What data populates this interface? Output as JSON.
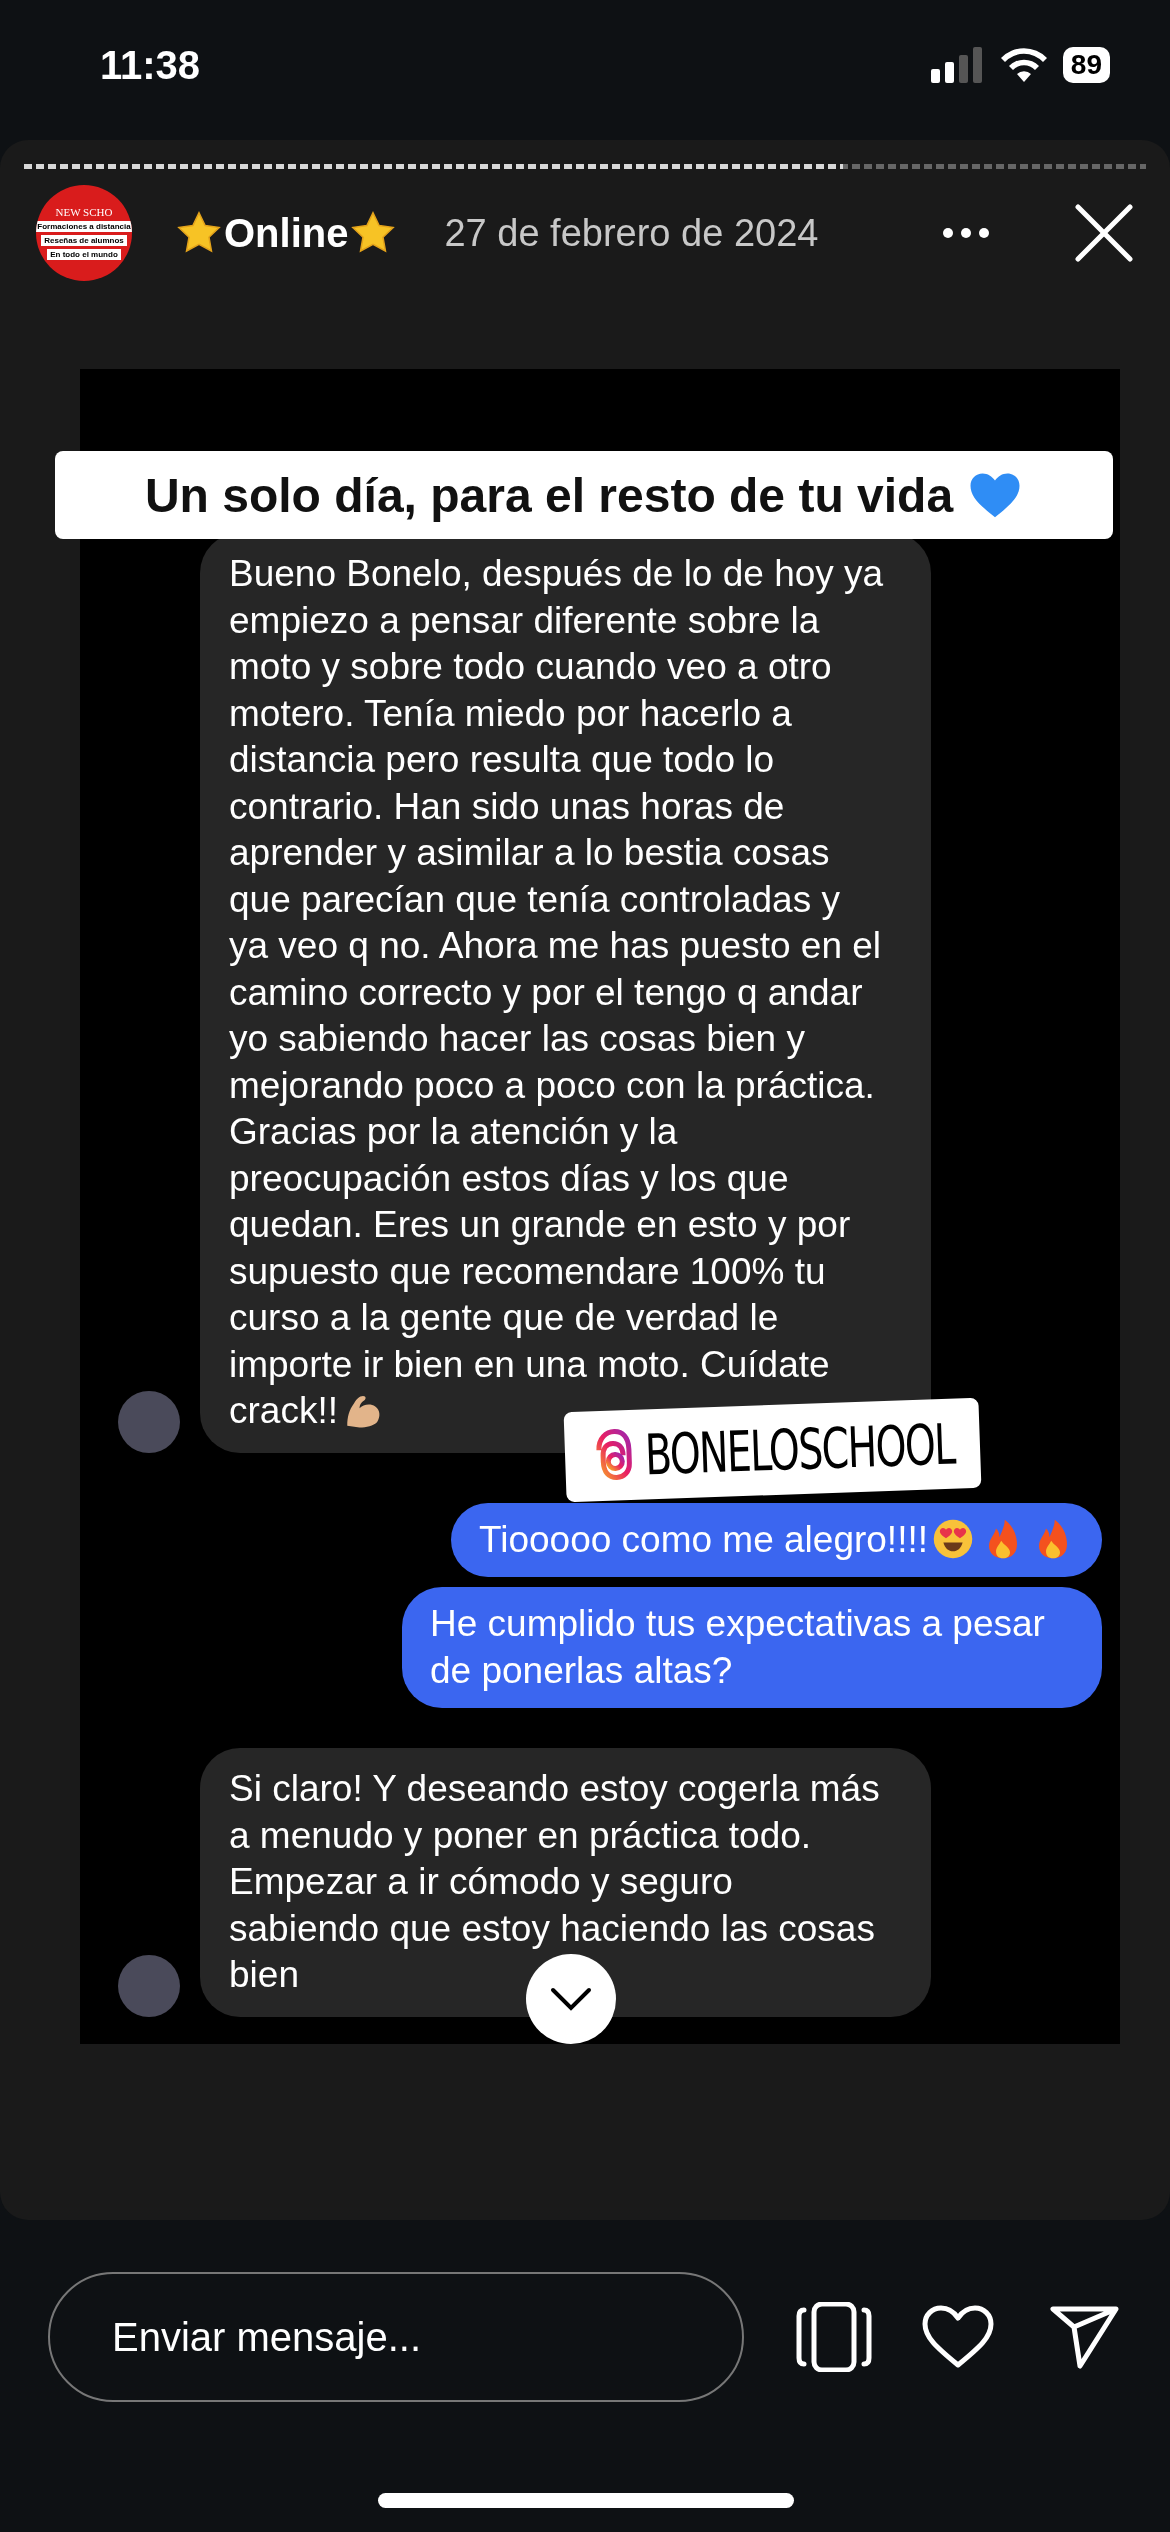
{
  "status_bar": {
    "time": "11:38",
    "battery": "89"
  },
  "story": {
    "progress": {
      "level": 0.73
    },
    "account": {
      "logo_texts": [
        "NEW SCHO",
        "Formaciones a distancia",
        "Reseñas de alumnos",
        "En todo el mundo"
      ],
      "name": "Online",
      "name_icons": [
        {
          "kind": "star"
        },
        {
          "kind": "star"
        }
      ]
    },
    "date": "27 de febrero de 2024",
    "banner": {
      "text": "Un solo día, para el resto de tu vida",
      "icons": [
        {
          "kind": "blue-heart"
        }
      ]
    },
    "mention": {
      "text": "BONELOSCHOOL"
    },
    "messages": [
      {
        "kind": "received",
        "text": "Bueno Bonelo, después de lo de hoy ya empiezo a pensar diferente sobre la moto y sobre todo cuando veo a otro motero. Tenía miedo por hacerlo a distancia pero resulta que todo lo contrario. Han sido unas horas de aprender y asimilar a lo bestia cosas que parecían que tenía controladas y ya veo q no. Ahora me has puesto en el camino correcto y por el tengo q andar yo sabiendo hacer las cosas bien y mejorando poco a poco con la práctica. Gracias por la atención y la preocupación estos días y los que quedan. Eres un grande en esto y por supuesto que recomendare 100% tu curso a la gente que de verdad le importe ir bien en una moto. Cuídate crack!!",
        "icons": [
          {
            "kind": "flexed-arm"
          }
        ]
      },
      {
        "kind": "sent",
        "text": "Tiooooo como me alegro!!!!",
        "icons": [
          {
            "kind": "heart-eyes"
          },
          {
            "kind": "fire"
          },
          {
            "kind": "fire"
          }
        ]
      },
      {
        "kind": "sent",
        "text": "He cumplido tus expectativas a pesar de ponerlas altas?"
      },
      {
        "kind": "received",
        "text": "Si claro! Y deseando estoy cogerla más a menudo y poner en práctica todo. Empezar a ir cómodo y seguro sabiendo que estoy haciendo las cosas bien"
      }
    ]
  },
  "reply": {
    "placeholder": "Enviar mensaje..."
  }
}
